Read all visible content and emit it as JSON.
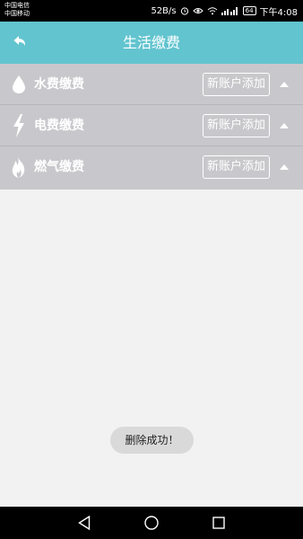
{
  "status_bar": {
    "carrier_1": "中国电信",
    "carrier_2": "中国移动",
    "net_speed": "52B/s",
    "battery": "64",
    "time": "下午4:08"
  },
  "app_bar": {
    "title": "生活缴费",
    "back_icon": "back-arrow-icon"
  },
  "bill_items": [
    {
      "label": "水费缴费",
      "icon": "water-drop-icon",
      "add_label": "新账户添加"
    },
    {
      "label": "电费缴费",
      "icon": "lightning-icon",
      "add_label": "新账户添加"
    },
    {
      "label": "燃气缴费",
      "icon": "flame-icon",
      "add_label": "新账户添加"
    }
  ],
  "toast": {
    "message": "删除成功！"
  },
  "colors": {
    "app_bar": "#62c4cf",
    "list_bg": "#c8c8cc",
    "background": "#f2f2f2"
  }
}
